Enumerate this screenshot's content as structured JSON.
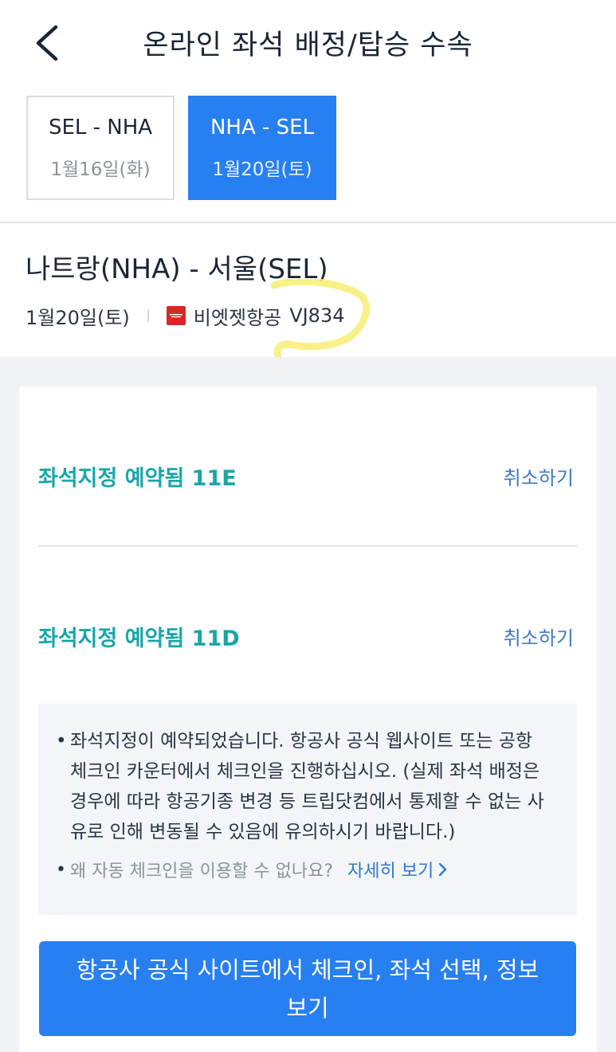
{
  "header": {
    "title": "온라인 좌석 배정/탑승 수속",
    "back_icon": "chevron-left-icon"
  },
  "tabs": [
    {
      "route": "SEL - NHA",
      "date": "1월16일(화)",
      "active": false
    },
    {
      "route": "NHA - SEL",
      "date": "1월20일(토)",
      "active": true
    }
  ],
  "flight": {
    "title": "나트랑(NHA) - 서울(SEL)",
    "date": "1월20일(토)",
    "airline_name": "비엣젯항공",
    "flight_number": "VJ834",
    "airline_logo_color": "#e02424"
  },
  "seats": [
    {
      "status": "좌석지정 예약됨 11E",
      "cancel_label": "취소하기"
    },
    {
      "status": "좌석지정 예약됨 11D",
      "cancel_label": "취소하기"
    }
  ],
  "notice": {
    "bullet": "•",
    "text": "좌석지정이 예약되었습니다. 항공사 공식 웹사이트 또는 공항 체크인 카운터에서 체크인을 진행하십시오. (실제 좌석 배정은 경우에 따라 항공기종 변경 등 트립닷컴에서 통제할 수 없는 사유로 인해 변동될 수 있음에 유의하시기 바랍니다.)",
    "question": "왜 자동 체크인을 이용할 수 없나요?",
    "detail_link": "자세히 보기"
  },
  "cta_label": "항공사 공식 사이트에서 체크인, 좌석 선택, 정보 보기",
  "colors": {
    "accent": "#287ff0",
    "seat_status": "#18a6a8",
    "link": "#3c79c8",
    "highlight": "#f7f07a"
  }
}
